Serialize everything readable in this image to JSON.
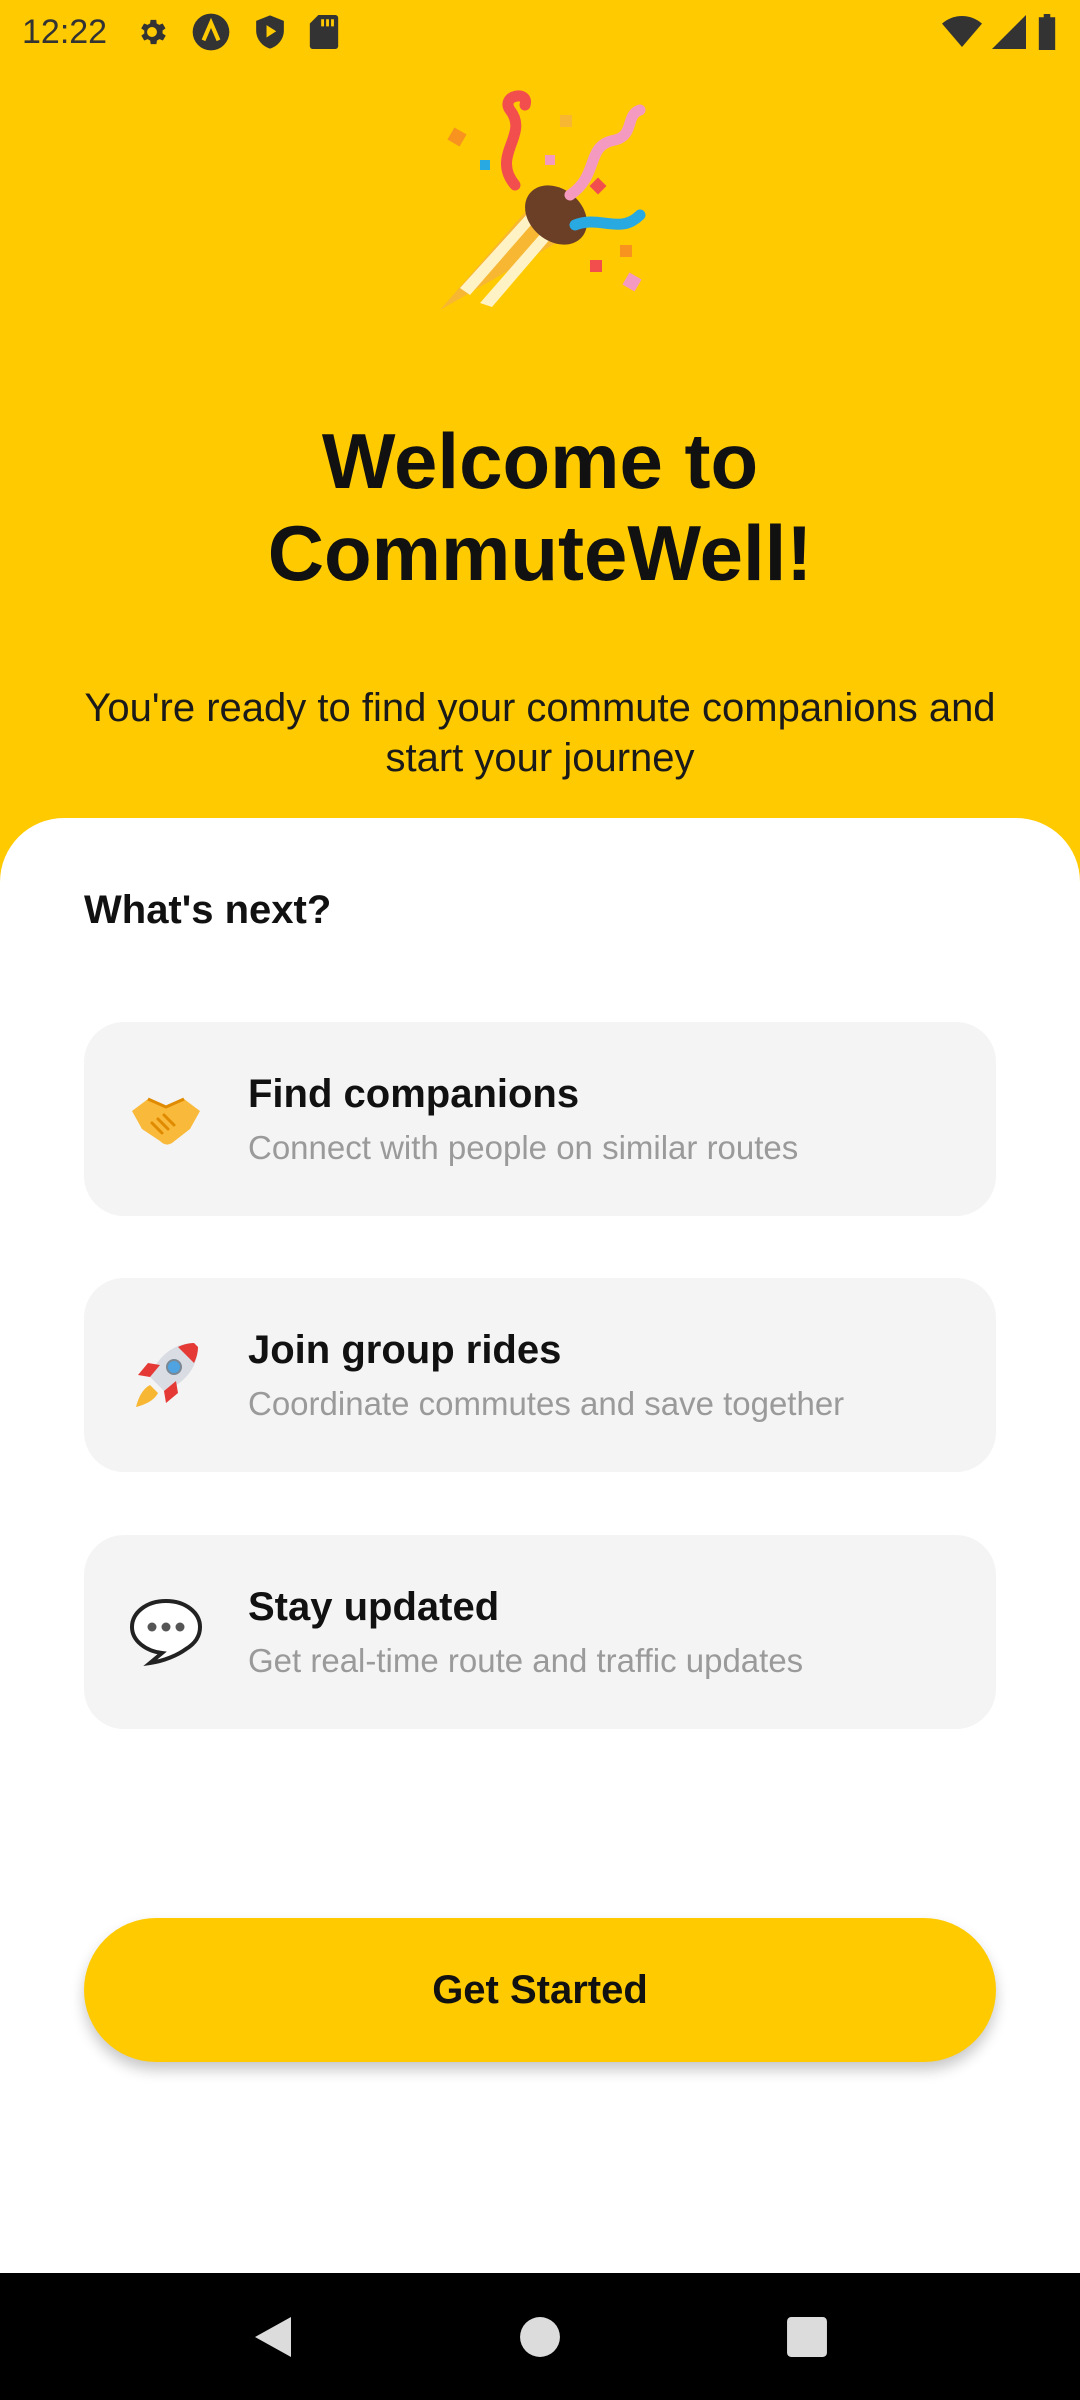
{
  "status_bar": {
    "time": "12:22",
    "left_icons": [
      "gear-icon",
      "a-circle-icon",
      "shield-play-icon",
      "sd-card-icon"
    ],
    "right_icons": [
      "wifi-icon",
      "signal-icon",
      "battery-icon"
    ]
  },
  "hero": {
    "icon": "party-popper-icon",
    "title_line1": "Welcome to",
    "title_line2": "CommuteWell!",
    "subtitle": "You're ready to find your commute companions and start your journey"
  },
  "next": {
    "heading": "What's next?",
    "items": [
      {
        "icon": "handshake-icon",
        "title": "Find companions",
        "description": "Connect with people on similar routes"
      },
      {
        "icon": "rocket-icon",
        "title": "Join group rides",
        "description": "Coordinate commutes and save together"
      },
      {
        "icon": "speech-bubble-icon",
        "title": "Stay updated",
        "description": "Get real-time route and traffic updates"
      }
    ]
  },
  "cta": {
    "label": "Get Started"
  },
  "colors": {
    "accent": "#FFCA00",
    "card_bg": "#F4F4F4",
    "muted_text": "#9A9A9A"
  },
  "nav_bar": [
    "back-icon",
    "home-icon",
    "recents-icon"
  ]
}
